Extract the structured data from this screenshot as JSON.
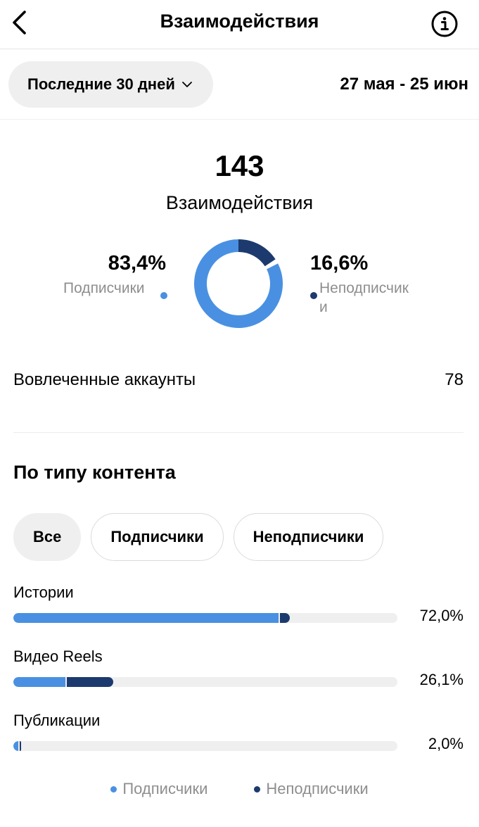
{
  "header": {
    "title": "Взаимодействия",
    "back_icon": "chevron-left-icon",
    "info_icon": "info-circle-icon"
  },
  "filter": {
    "period_label": "Последние 30 дней",
    "date_range": "27 мая - 25 июн"
  },
  "summary": {
    "total": "143",
    "total_label": "Взаимодействия",
    "followers_pct": "83,4%",
    "followers_label": "Подписчики",
    "nonfollowers_pct": "16,6%",
    "nonfollowers_label": "Неподписчики",
    "followers_share": 0.834,
    "nonfollowers_share": 0.166
  },
  "accounts": {
    "label": "Вовлеченные аккаунты",
    "value": "78"
  },
  "content_type": {
    "title": "По типу контента",
    "chips": [
      {
        "label": "Все",
        "active": true
      },
      {
        "label": "Подписчики",
        "active": false
      },
      {
        "label": "Неподписчики",
        "active": false
      }
    ],
    "rows": [
      {
        "label": "Истории",
        "value": "72,0%",
        "total_share": 0.72,
        "followers_share": 0.69,
        "nonfollowers_share": 0.03
      },
      {
        "label": "Видео Reels",
        "value": "26,1%",
        "total_share": 0.261,
        "followers_share": 0.135,
        "nonfollowers_share": 0.126
      },
      {
        "label": "Публикации",
        "value": "2,0%",
        "total_share": 0.02,
        "followers_share": 0.012,
        "nonfollowers_share": 0.008
      }
    ]
  },
  "legend": {
    "followers": "Подписчики",
    "nonfollowers": "Неподписчики"
  },
  "colors": {
    "followers": "#4a90e2",
    "nonfollowers": "#1c3a6e",
    "track": "#efefef",
    "muted_text": "#8e8e8e"
  }
}
